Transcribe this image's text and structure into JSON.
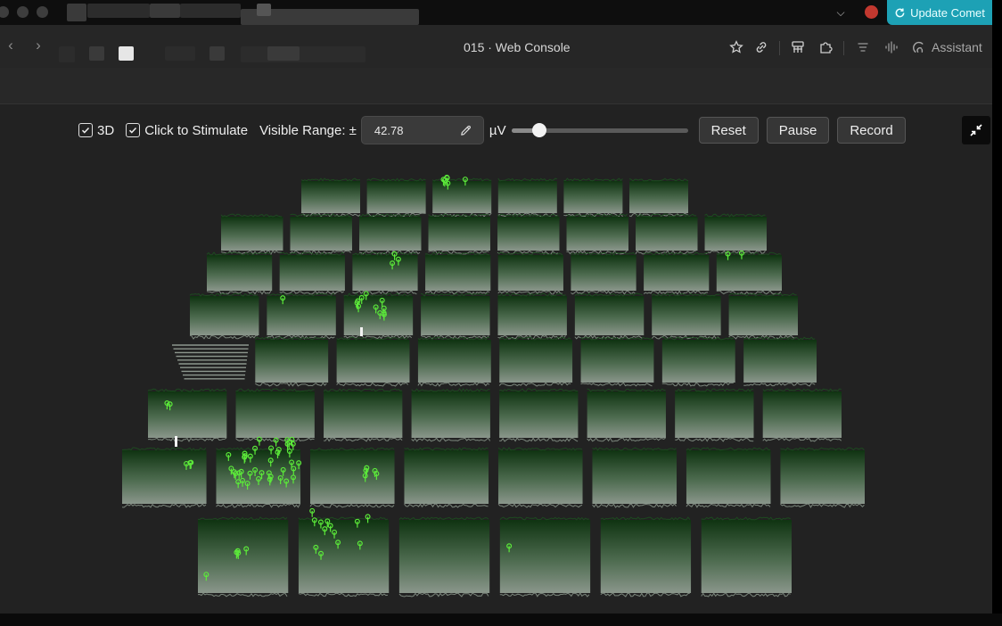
{
  "browser": {
    "update_button_label": "Update Comet",
    "page_title": "015 · Web Console",
    "assistant_label": "Assistant"
  },
  "controls": {
    "checkbox_3d_label": "3D",
    "checkbox_3d_checked": true,
    "checkbox_stimulate_label": "Click to Stimulate",
    "checkbox_stimulate_checked": true,
    "visible_range_label": "Visible Range: ±",
    "visible_range_value": "42.78",
    "unit_label": "µV",
    "slider_level": 0.16,
    "reset_label": "Reset",
    "pause_label": "Pause",
    "record_label": "Record"
  },
  "colors": {
    "accent": "#1da1b5",
    "spike": "#5cea3a",
    "electrode_top": "#0f3311",
    "electrode_bottom": "#8a968b"
  },
  "icons": [
    "chevron-down-icon",
    "refresh-icon",
    "back-icon",
    "forward-icon",
    "star-icon",
    "link-icon",
    "extension-icon",
    "puzzle-icon",
    "menu-icon",
    "voice-icon",
    "assistant-icon",
    "pencil-icon",
    "exit-fullscreen-icon"
  ]
}
